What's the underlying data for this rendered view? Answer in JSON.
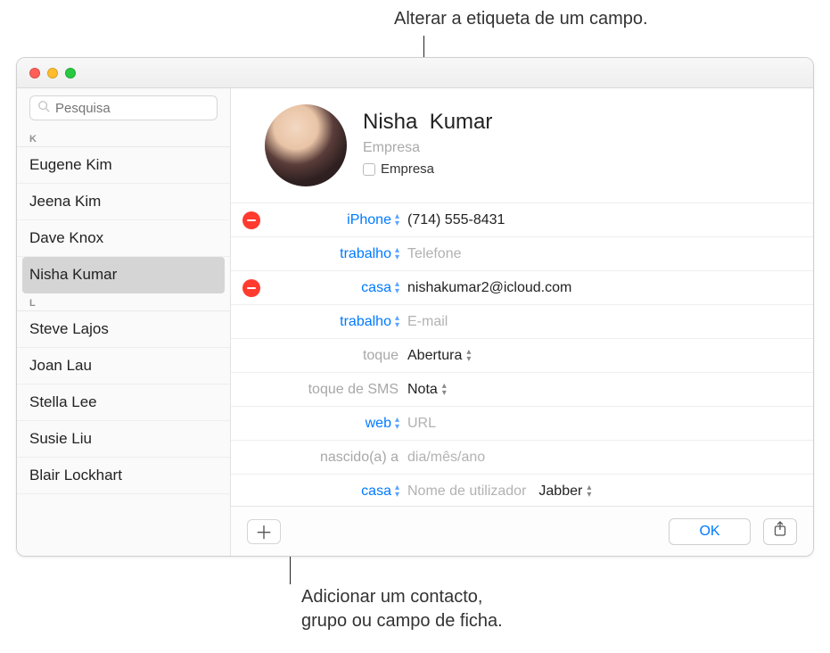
{
  "callouts": {
    "top": "Alterar a etiqueta de um campo.",
    "bottom_line1": "Adicionar um contacto,",
    "bottom_line2": "grupo ou campo de ficha."
  },
  "search": {
    "placeholder": "Pesquisa"
  },
  "sidebar": {
    "sections": [
      {
        "letter": "K",
        "items": [
          "Eugene Kim",
          "Jeena Kim",
          "Dave Knox",
          "Nisha Kumar"
        ]
      },
      {
        "letter": "L",
        "items": [
          "Steve Lajos",
          "Joan Lau",
          "Stella Lee",
          "Susie Liu",
          "Blair Lockhart"
        ]
      }
    ],
    "selected": "Nisha Kumar"
  },
  "contact": {
    "first_name": "Nisha",
    "last_name": "Kumar",
    "company_placeholder": "Empresa",
    "company_checkbox_label": "Empresa"
  },
  "fields": {
    "phone": {
      "label": "iPhone",
      "value": "(714) 555-8431"
    },
    "phone2": {
      "label": "trabalho",
      "placeholder": "Telefone"
    },
    "email": {
      "label": "casa",
      "value": "nishakumar2@icloud.com"
    },
    "email2": {
      "label": "trabalho",
      "placeholder": "E-mail"
    },
    "ringtone": {
      "label": "toque",
      "value": "Abertura"
    },
    "sms_tone": {
      "label": "toque de SMS",
      "value": "Nota"
    },
    "web": {
      "label": "web",
      "placeholder": "URL"
    },
    "birthday": {
      "label": "nascido(a) a",
      "placeholder": "dia/mês/ano"
    },
    "im": {
      "label": "casa",
      "placeholder": "Nome de utilizador",
      "service": "Jabber"
    }
  },
  "footer": {
    "ok_label": "OK"
  }
}
